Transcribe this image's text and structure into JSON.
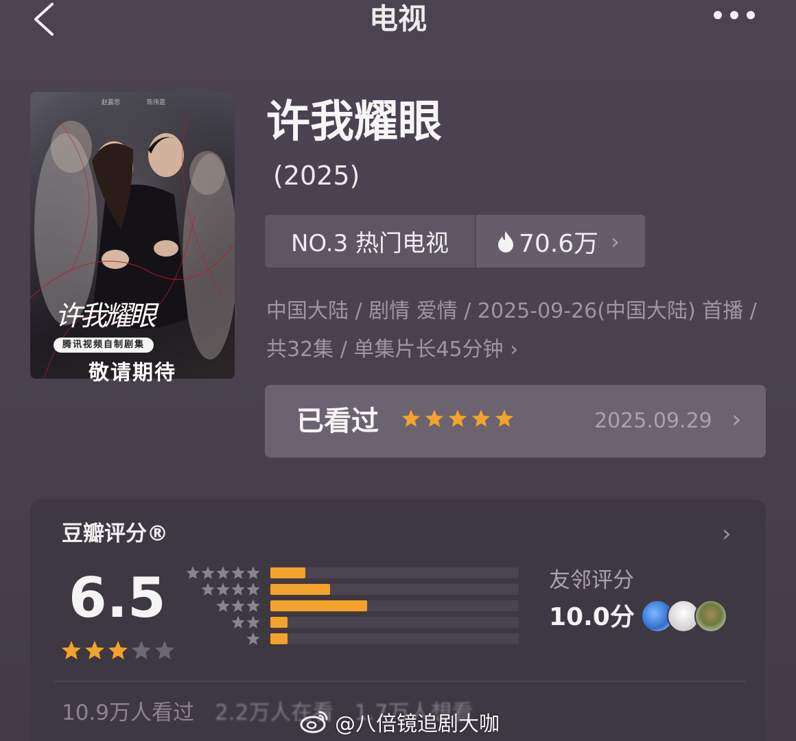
{
  "header": {
    "title": "电视"
  },
  "poster": {
    "cast_left": "赵露思",
    "cast_right": "陈伟霆",
    "title_art": "许我耀眼",
    "tag": "腾讯视频自制剧集",
    "soon": "敬请期待"
  },
  "show": {
    "title": "许我耀眼",
    "year": "(2025)"
  },
  "rank": {
    "label": "NO.3 热门电视",
    "heat": "70.6万",
    "heat_chevron": "›"
  },
  "meta": {
    "text": "中国大陆 / 剧情 爱情 / 2025-09-26(中国大陆) 首播 / 共32集 / 单集片长45分钟",
    "chevron": "›"
  },
  "watched": {
    "label": "已看过",
    "stars": 5,
    "date": "2025.09.29",
    "chevron": "›"
  },
  "rating": {
    "title": "豆瓣评分®",
    "chevron": "›",
    "score": "6.5",
    "stars_filled": 3,
    "stars_total": 5,
    "distribution": [
      {
        "stars": 5,
        "fraction": 0.14
      },
      {
        "stars": 4,
        "fraction": 0.24
      },
      {
        "stars": 3,
        "fraction": 0.39
      },
      {
        "stars": 2,
        "fraction": 0.07
      },
      {
        "stars": 1,
        "fraction": 0.07
      }
    ],
    "friends_label": "友邻评分",
    "friends_score": "10.0分"
  },
  "stats": {
    "watched": "10.9万人看过",
    "watching": "2.2万人在看",
    "want": "1.7万人想看"
  },
  "watermark": {
    "text": "@八倍镜追剧大咖"
  },
  "colors": {
    "accent": "#f3a22a",
    "background": "#4a424f",
    "card": "#3e3843"
  }
}
